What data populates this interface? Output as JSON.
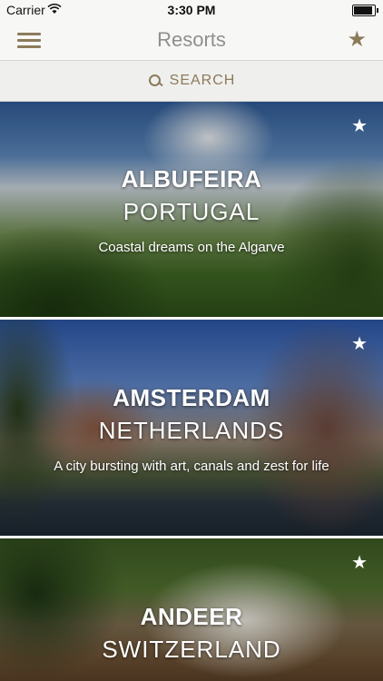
{
  "status_bar": {
    "carrier": "Carrier",
    "time": "3:30 PM",
    "battery_level": 1.0
  },
  "nav": {
    "title": "Resorts",
    "menu_icon": "hamburger-menu-icon",
    "favorites_icon": "star-icon",
    "accent_color": "#8c7a5a"
  },
  "search": {
    "label": "SEARCH",
    "icon": "search-icon"
  },
  "resorts": [
    {
      "city": "ALBUFEIRA",
      "country": "PORTUGAL",
      "tagline": "Coastal dreams on the Algarve",
      "favorite_icon": "star-icon"
    },
    {
      "city": "AMSTERDAM",
      "country": "NETHERLANDS",
      "tagline": "A city bursting with art, canals and zest for life",
      "favorite_icon": "star-icon"
    },
    {
      "city": "ANDEER",
      "country": "SWITZERLAND",
      "tagline": "",
      "favorite_icon": "star-icon"
    }
  ]
}
